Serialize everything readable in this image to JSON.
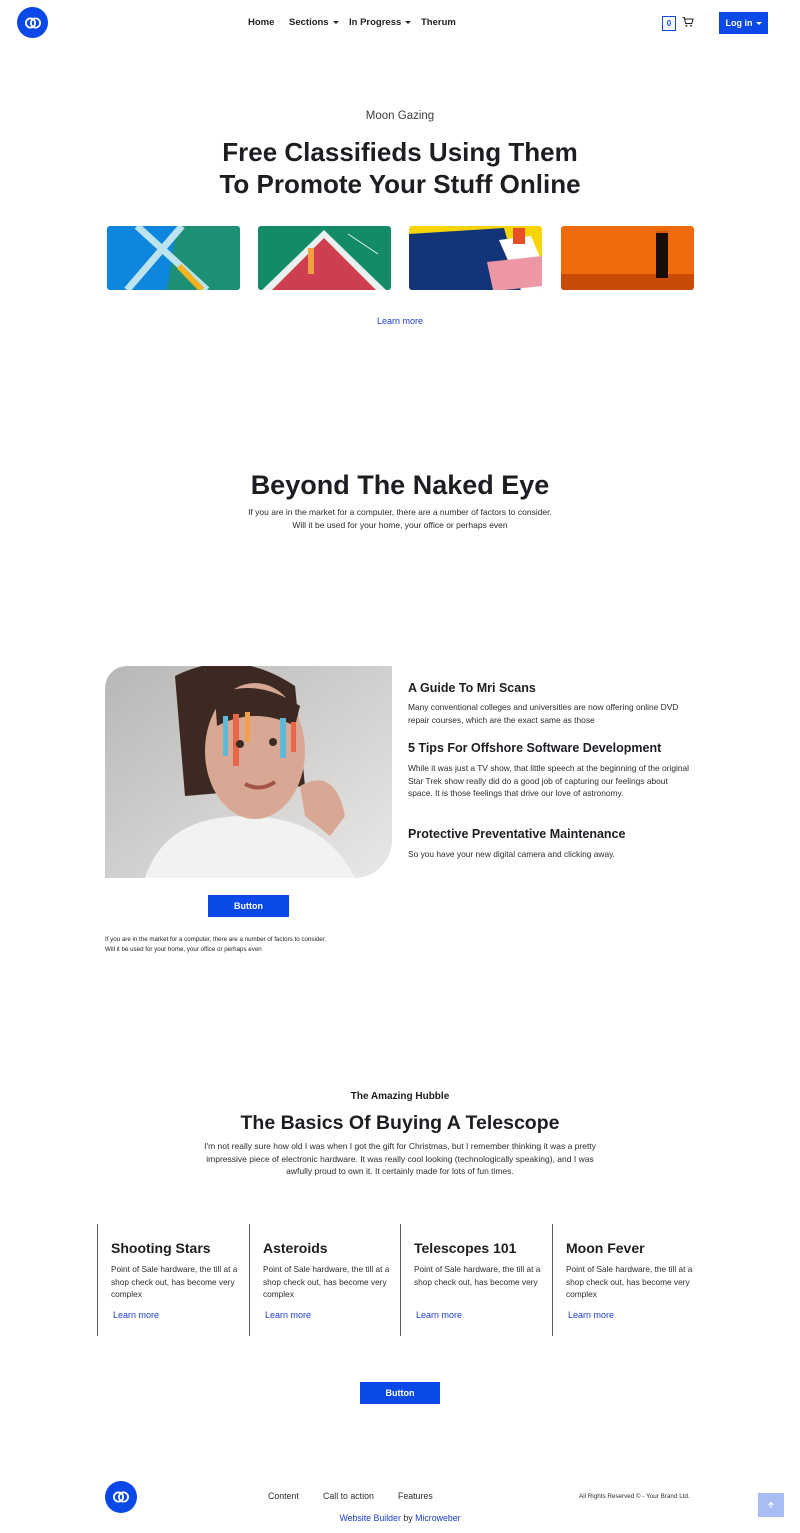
{
  "header": {
    "nav": [
      {
        "label": "Home",
        "dropdown": false
      },
      {
        "label": "Sections",
        "dropdown": true
      },
      {
        "label": "In Progress",
        "dropdown": true
      },
      {
        "label": "Therum",
        "dropdown": false
      }
    ],
    "cart_count": "0",
    "login_label": "Log in"
  },
  "hero": {
    "subtitle": "Moon Gazing",
    "title_line1": "Free Classifieds Using Them",
    "title_line2": "To Promote Your Stuff Online",
    "learn_more": "Learn more"
  },
  "section2": {
    "title": "Beyond The Naked Eye",
    "line1": "If you are in the market for a computer, there are a number of factors to consider.",
    "line2": "Will it be used for your home, your office or perhaps even"
  },
  "section3": {
    "features": [
      {
        "title": "A Guide To Mri Scans",
        "text": "Many conventional colleges and universities are now offering online DVD repair courses, which are the exact same as those"
      },
      {
        "title": "5 Tips For Offshore Software Development",
        "text": "While it was just a TV show, that little speech at the beginning of the original Star Trek show really did do a good job of capturing our feelings about space. It is those feelings that drive our love of astronomy."
      },
      {
        "title": "Protective Preventative Maintenance",
        "text": "So you have your new digital camera and clicking away."
      }
    ],
    "button_label": "Button",
    "note_line1": "If you are in the market for a computer, there are a number of factors to consider.",
    "note_line2": "Will it be used for your home, your office or perhaps even"
  },
  "section4": {
    "eyebrow": "The Amazing Hubble",
    "title": "The Basics Of Buying A Telescope",
    "paragraph": "I'm not really sure how old I was when I got the gift for Christmas, but I remember thinking it was a pretty impressive piece of electronic hardware. It was really cool looking (technologically speaking), and I was awfully proud to own it. It certainly made for lots of fun times.",
    "cards": [
      {
        "title": "Shooting Stars",
        "text": "Point of Sale hardware, the till at a shop check out, has become very complex",
        "link": "Learn more"
      },
      {
        "title": "Asteroids",
        "text": "Point of Sale hardware, the till at a shop check out, has become very complex",
        "link": "Learn more"
      },
      {
        "title": "Telescopes 101",
        "text": "Point of Sale hardware, the till at a shop check out, has become very",
        "link": "Learn more"
      },
      {
        "title": "Moon Fever",
        "text": "Point of Sale hardware, the till at a shop check out, has become very complex",
        "link": "Learn more"
      }
    ],
    "button_label": "Button"
  },
  "footer": {
    "links": [
      "Content",
      "Call to action",
      "Features"
    ],
    "rights": "All Rights Reserved © - Your Brand Ltd.",
    "builder_link": "Website Builder",
    "by": "by",
    "platform_link": "Microweber"
  },
  "colors": {
    "accent": "#0a48e8",
    "link": "#1d3ec8",
    "text": "#1c1e23",
    "scroll_top_bg": "#a9bdf2"
  },
  "icons": [
    "logo-rings-icon",
    "cart-icon",
    "chevron-down-icon",
    "arrow-up-icon"
  ]
}
